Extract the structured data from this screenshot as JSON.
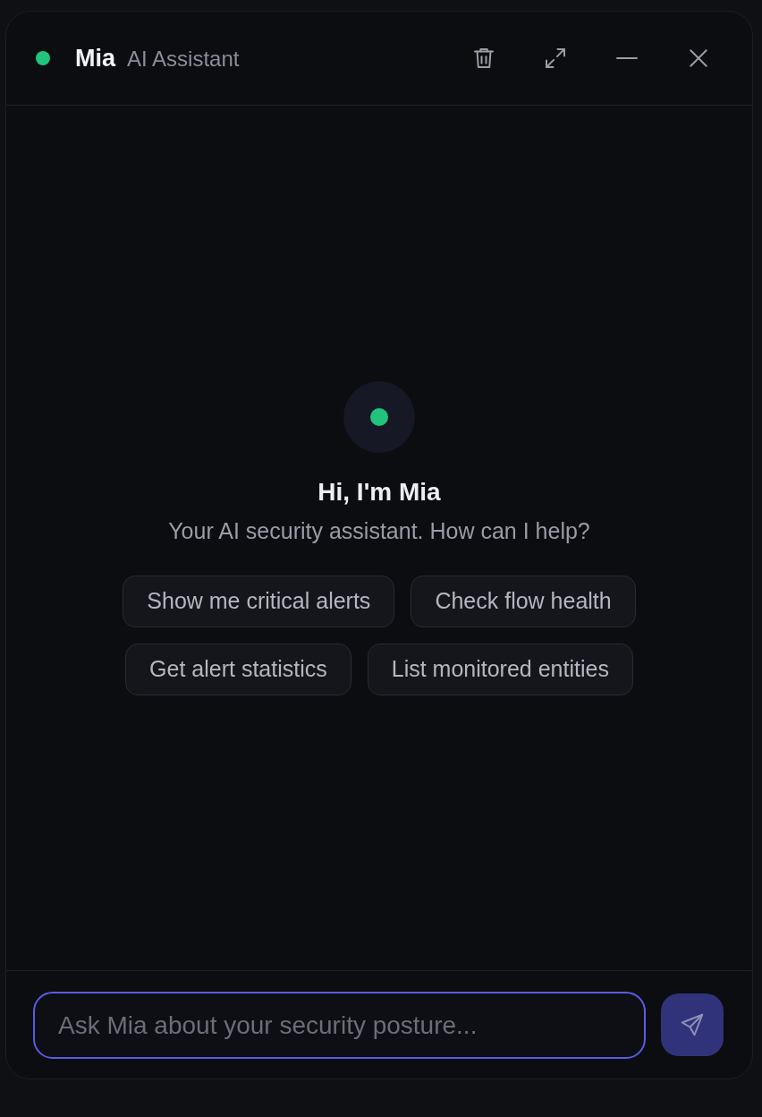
{
  "header": {
    "name": "Mia",
    "subtitle": "AI Assistant",
    "online": true,
    "actions": [
      {
        "kind": "delete"
      },
      {
        "kind": "expand"
      },
      {
        "kind": "minimize"
      },
      {
        "kind": "close"
      }
    ]
  },
  "welcome": {
    "title": "Hi, I'm Mia",
    "subtitle": "Your AI security assistant. How can I help?",
    "suggestion_rows": [
      [
        "Show me critical alerts",
        "Check flow health"
      ],
      [
        "Get alert statistics",
        "List monitored entities"
      ]
    ]
  },
  "composer": {
    "placeholder": "Ask Mia about your security posture...",
    "focused": true
  }
}
